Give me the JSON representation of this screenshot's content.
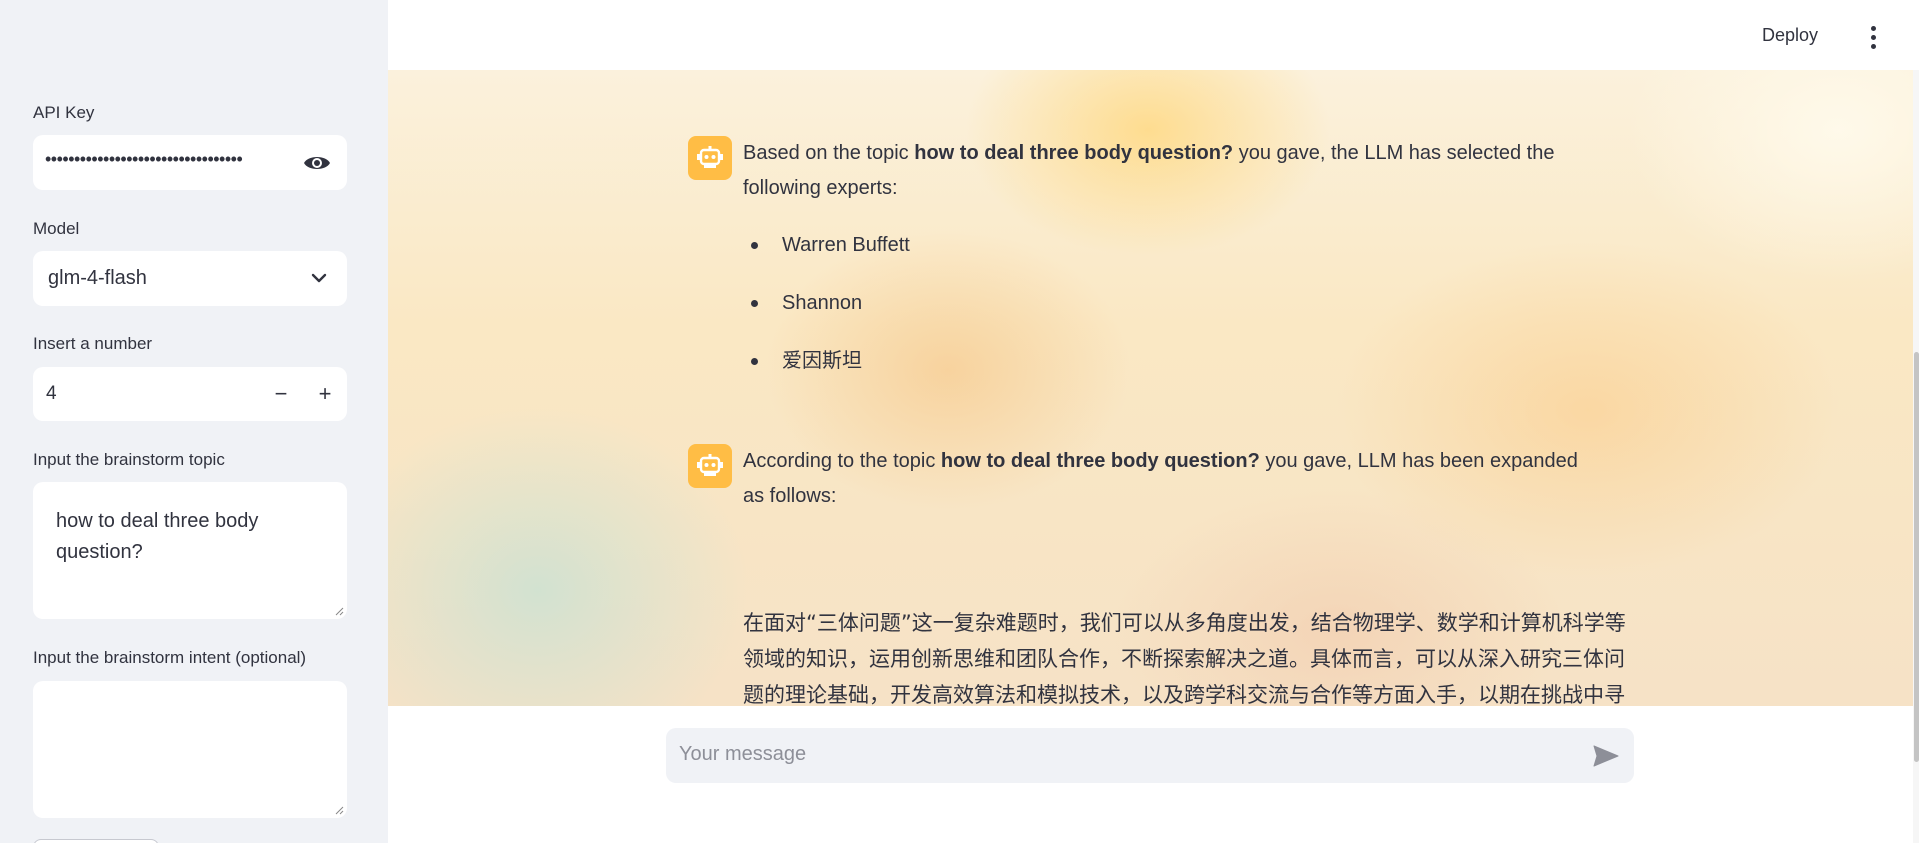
{
  "sidebar": {
    "api_key": {
      "label": "API Key",
      "masked_value": "••••••••••••••••••••••••••••••••••",
      "toggle_icon": "eye-icon"
    },
    "model": {
      "label": "Model",
      "selected": "glm-4-flash",
      "icon": "chevron-down-icon"
    },
    "number": {
      "label": "Insert a number",
      "value": "4",
      "minus": "−",
      "plus": "+"
    },
    "topic": {
      "label": "Input the brainstorm topic",
      "value": "how to deal three body question?"
    },
    "intent": {
      "label": "Input the brainstorm intent (optional)",
      "value": ""
    }
  },
  "header": {
    "deploy_label": "Deploy",
    "menu_icon": "kebab-menu-icon"
  },
  "messages": [
    {
      "avatar_icon": "robot-icon",
      "prefix": "Based on the topic ",
      "topic": "how to deal three body question?",
      "suffix": " you gave, the LLM has selected the following experts:",
      "experts": [
        "Warren Buffett",
        "Shannon",
        "爱因斯坦"
      ]
    },
    {
      "avatar_icon": "robot-icon",
      "prefix": "According to the topic ",
      "topic": "how to deal three body question?",
      "suffix": " you gave, LLM has been expanded as follows:",
      "body": "在面对“三体问题”这一复杂难题时，我们可以从多角度出发，结合物理学、数学和计算机科学等领域的知识，运用创新思维和团队合作，不断探索解决之道。具体而言，可以从深入研究三体问题的理论基础，开发高效算法和模拟技术，以及跨学科交流与合作等方面入手，以期在挑战中寻求突破，为人类探索宇宙奥秘贡献智慧与力量。"
    }
  ],
  "chat_input": {
    "placeholder": "Your message",
    "send_icon": "send-icon"
  },
  "colors": {
    "sidebar_bg": "#f0f2f6",
    "avatar_bg": "#ffbd45",
    "text": "#31333f",
    "placeholder": "#8d8f98"
  }
}
